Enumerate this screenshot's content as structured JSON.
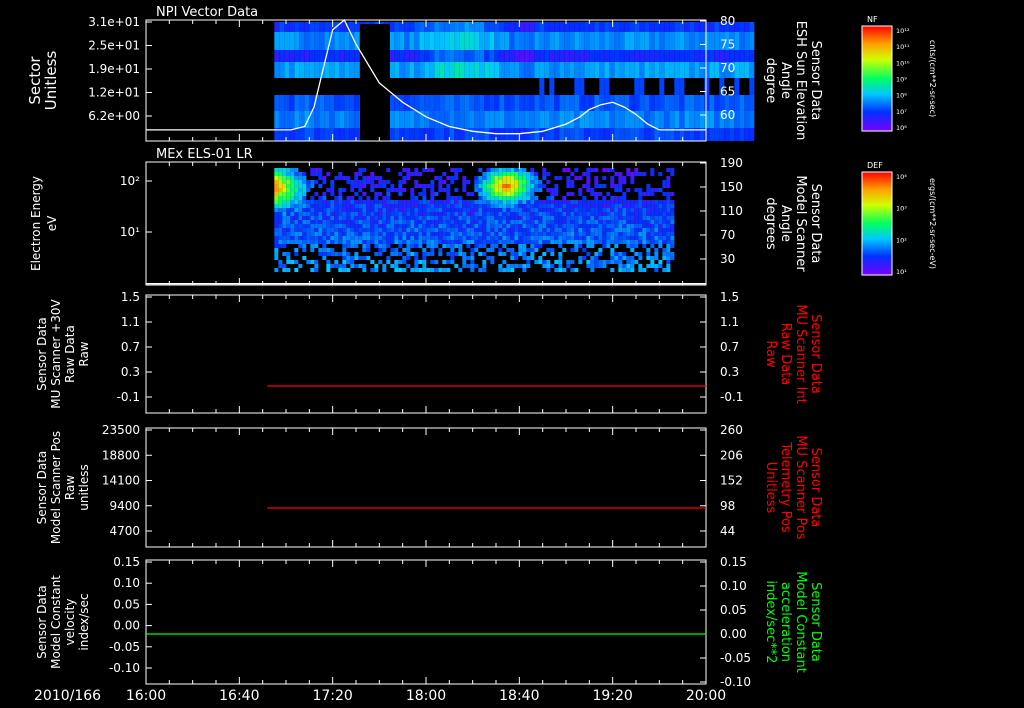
{
  "chart_data": [
    {
      "type": "heatmap",
      "title": "NPI Vector Data",
      "ylabel": [
        "Sector",
        "Unitless"
      ],
      "yticks": [
        "3.1e+01",
        "2.5e+01",
        "1.9e+01",
        "1.2e+01",
        "6.2e+00"
      ],
      "y2label": [
        "Sensor Data",
        "ESH Sun Elevation",
        "Angle",
        "degree"
      ],
      "y2ticks": [
        "80",
        "75",
        "70",
        "65",
        "60"
      ],
      "y2lim": [
        55,
        80
      ],
      "colorbar": {
        "label": "NF",
        "unit": "cnts/(cm**2-sr-sec)",
        "ticks": [
          "10¹²",
          "10¹¹",
          "10¹⁰",
          "10⁹",
          "10⁸",
          "10⁷",
          "10⁶"
        ],
        "scale": "log"
      },
      "data_span_min": [
        55,
        260
      ],
      "overlay_line": {
        "name": "ESH Sun Elevation Angle",
        "color": "#ffffff",
        "x_min": [
          0,
          55,
          62,
          68,
          72,
          76,
          80,
          85,
          90,
          100,
          110,
          120,
          130,
          140,
          150,
          160,
          170,
          180,
          186,
          190,
          195,
          200,
          205,
          210,
          215,
          220,
          225,
          260
        ],
        "y_deg": [
          57.3,
          57.3,
          57.3,
          58,
          62,
          70,
          78,
          80,
          75,
          67,
          63,
          60,
          58,
          57,
          56.5,
          56.5,
          57,
          58.5,
          60,
          61.5,
          62.5,
          63,
          62,
          60.5,
          58.5,
          57.3,
          57.3,
          57.3
        ]
      }
    },
    {
      "type": "heatmap",
      "title": "MEx ELS-01 LR",
      "ylabel": [
        "Electron Energy",
        "eV"
      ],
      "yticks": [
        "10²",
        "10¹"
      ],
      "y2label": [
        "Sensor Data",
        "Model Scanner",
        "Angle",
        "degrees"
      ],
      "y2ticks": [
        "190",
        "150",
        "110",
        "70",
        "30"
      ],
      "y2lim": [
        0,
        190
      ],
      "colorbar": {
        "label": "DEF",
        "unit": "ergs/(cm**2-sr-sec-eV)",
        "ticks": [
          "10⁴",
          "10³",
          "10²",
          "10¹"
        ],
        "scale": "log"
      },
      "data_span_min": [
        55,
        225
      ],
      "overlay_line": {
        "name": "Model Scanner Angle",
        "color": "#ffffff",
        "x_min": [
          0,
          260
        ],
        "y_deg": [
          2,
          2
        ]
      }
    },
    {
      "type": "line",
      "ylabel": [
        "Sensor Data",
        "MU Scanner +30V",
        "Raw Data",
        "Raw"
      ],
      "yticks": [
        "1.5",
        "1.1",
        "0.7",
        "0.3",
        "-0.1"
      ],
      "ylim": [
        -0.3,
        1.5
      ],
      "y2label": [
        "Sensor Data",
        "MU Scanner Int",
        "Raw Data",
        "Raw"
      ],
      "y2label_color": "#ff0000",
      "y2ticks": [
        "1.5",
        "1.1",
        "0.7",
        "0.3",
        "-0.1"
      ],
      "series": [
        {
          "color": "#ff0000",
          "x_min": [
            52,
            260
          ],
          "values": [
            0.0,
            0.0
          ]
        }
      ]
    },
    {
      "type": "line",
      "ylabel": [
        "Sensor Data",
        "Model Scanner Pos",
        "Raw",
        "unitless"
      ],
      "yticks": [
        "23500",
        "18800",
        "14100",
        "9400",
        "4700"
      ],
      "ylim": [
        0,
        23500
      ],
      "y2label": [
        "Sensor Data",
        "MU Scanner Pos",
        "Telemetry Pos",
        "Unitless"
      ],
      "y2label_color": "#ff0000",
      "y2ticks": [
        "260",
        "206",
        "152",
        "98",
        "44"
      ],
      "series": [
        {
          "color": "#ff0000",
          "x_min": [
            52,
            260
          ],
          "values": [
            7800,
            7800
          ]
        }
      ]
    },
    {
      "type": "line",
      "ylabel": [
        "Sensor Data",
        "Model Constant",
        "velocity",
        "index/sec"
      ],
      "yticks": [
        "0.15",
        "0.10",
        "0.05",
        "0.00",
        "-0.05",
        "-0.10"
      ],
      "ylim": [
        -0.1,
        0.15
      ],
      "y2label": [
        "Sensor Data",
        "Model Constant",
        "acceleration",
        "index/sec**2"
      ],
      "y2label_color": "#00ff00",
      "y2ticks": [
        "0.15",
        "0.10",
        "0.05",
        "0.00",
        "-0.05",
        "-0.10"
      ],
      "series": [
        {
          "color": "#00ff00",
          "x_min": [
            0,
            260
          ],
          "values": [
            0.0,
            0.0
          ]
        }
      ]
    }
  ],
  "xaxis": {
    "date": "2010/166",
    "ticks": [
      "16:00",
      "16:40",
      "17:20",
      "18:00",
      "18:40",
      "19:20",
      "20:00"
    ],
    "range_min": [
      0,
      240
    ]
  }
}
